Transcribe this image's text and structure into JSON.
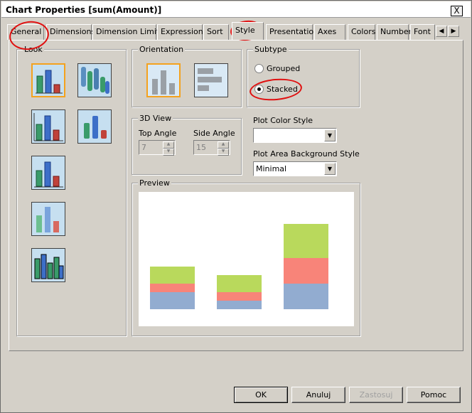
{
  "window": {
    "title": "Chart Properties [sum(Amount)]",
    "close_glyph": "X"
  },
  "tabs": [
    {
      "label": "General"
    },
    {
      "label": "Dimensions"
    },
    {
      "label": "Dimension Limits"
    },
    {
      "label": "Expressions"
    },
    {
      "label": "Sort"
    },
    {
      "label": "Style",
      "active": true
    },
    {
      "label": "Presentation"
    },
    {
      "label": "Axes"
    },
    {
      "label": "Colors"
    },
    {
      "label": "Number"
    },
    {
      "label": "Font"
    }
  ],
  "tab_scroll": {
    "left_glyph": "◀",
    "right_glyph": "▶"
  },
  "look": {
    "label": "Look",
    "selected_index": 0
  },
  "orientation": {
    "label": "Orientation",
    "selected": "vertical"
  },
  "subtype": {
    "label": "Subtype",
    "options": [
      {
        "label": "Grouped",
        "checked": false
      },
      {
        "label": "Stacked",
        "checked": true
      }
    ]
  },
  "view3d": {
    "label": "3D View",
    "top_angle_label": "Top Angle",
    "top_angle_value": "7",
    "side_angle_label": "Side Angle",
    "side_angle_value": "15"
  },
  "plot_color_style": {
    "label": "Plot Color Style",
    "value": ""
  },
  "plot_area_bg": {
    "label": "Plot Area Background Style",
    "value": "Minimal"
  },
  "preview": {
    "label": "Preview"
  },
  "preview_chart": {
    "type": "bar",
    "stacked": true,
    "categories": [
      "",
      "",
      ""
    ],
    "series": [
      {
        "color": "#92acd0",
        "values": [
          24,
          12,
          36
        ]
      },
      {
        "color": "#f88479",
        "values": [
          12,
          12,
          36
        ]
      },
      {
        "color": "#b9d95c",
        "values": [
          24,
          24,
          48
        ]
      }
    ]
  },
  "buttons": {
    "ok": "OK",
    "cancel": "Anuluj",
    "apply": "Zastosuj",
    "help": "Pomoc"
  }
}
